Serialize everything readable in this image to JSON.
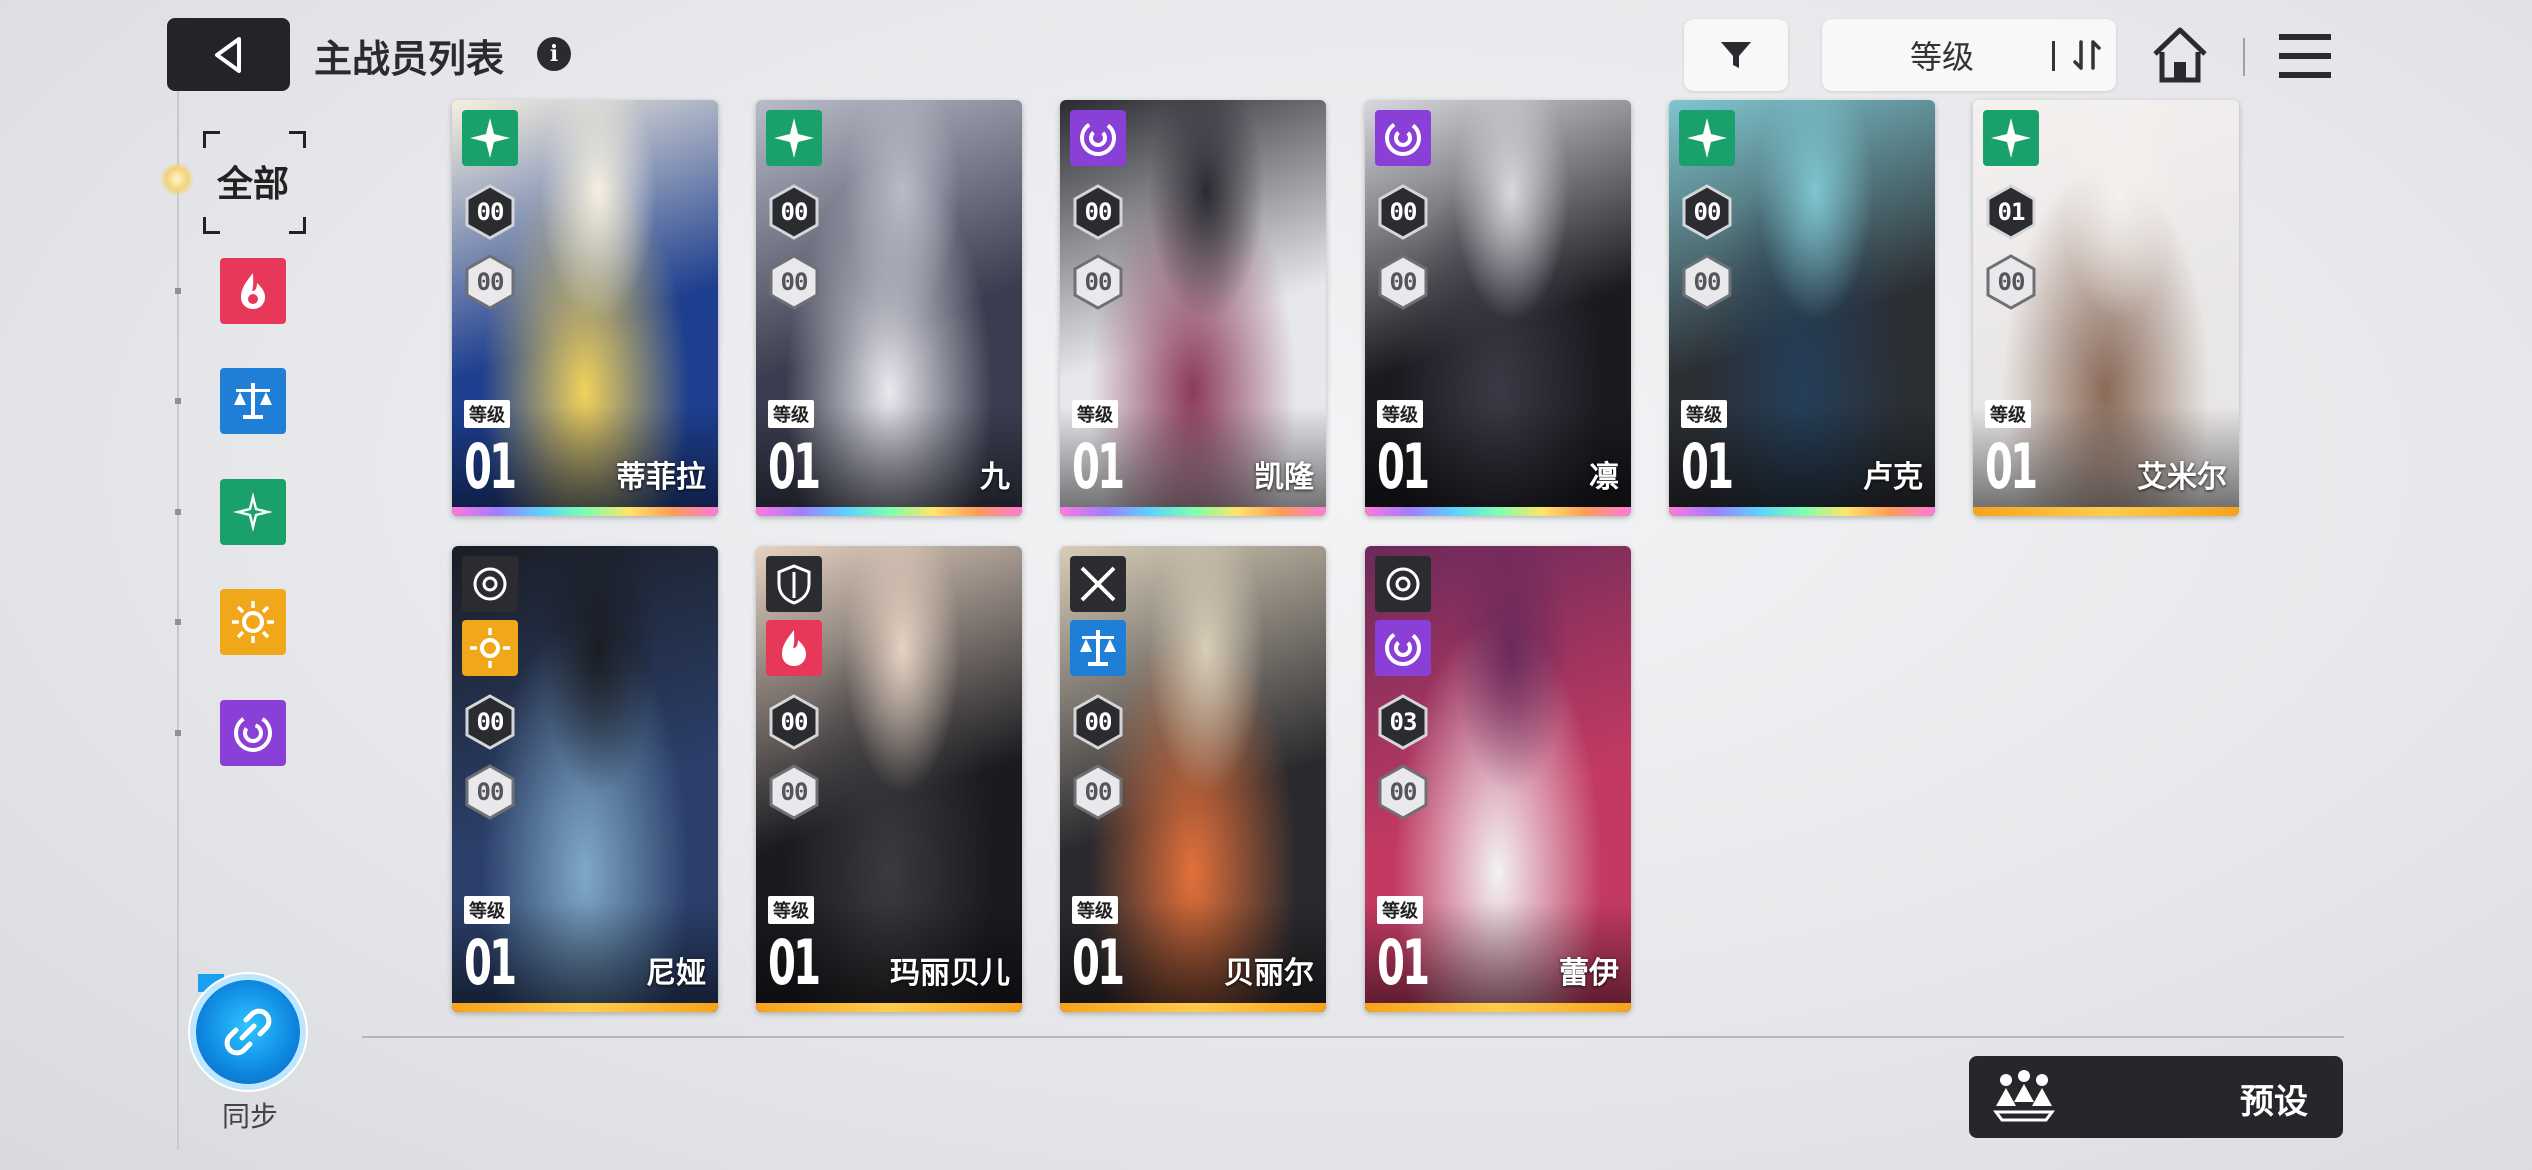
{
  "header": {
    "title": "主战员列表",
    "info_glyph": "i",
    "sort_label": "等级"
  },
  "sidebar": {
    "all_label": "全部",
    "filters": [
      {
        "name": "fire",
        "color": "#e8385a"
      },
      {
        "name": "balance",
        "color": "#1f7fd6"
      },
      {
        "name": "wind",
        "color": "#1aa06a"
      },
      {
        "name": "sun",
        "color": "#f0a81a"
      },
      {
        "name": "void",
        "color": "#8a3fd6"
      }
    ],
    "sync_label": "同步"
  },
  "cards": [
    {
      "name": "蒂菲拉",
      "level_label": "等级",
      "level": "01",
      "stat1": "00",
      "stat2": "00",
      "element": "wind",
      "bar": "rainbow",
      "palette": [
        "#1e3f8f",
        "#f1d25a",
        "#f6f0e0"
      ]
    },
    {
      "name": "九",
      "level_label": "等级",
      "level": "01",
      "stat1": "00",
      "stat2": "00",
      "element": "wind",
      "bar": "rainbow",
      "palette": [
        "#3a3d4f",
        "#e9e9ef",
        "#b9bcc8"
      ]
    },
    {
      "name": "凯隆",
      "level_label": "等级",
      "level": "01",
      "stat1": "00",
      "stat2": "00",
      "element": "void",
      "bar": "rainbow",
      "palette": [
        "#e7e8ec",
        "#8b3a5a",
        "#2a2b32"
      ]
    },
    {
      "name": "凛",
      "level_label": "等级",
      "level": "01",
      "stat1": "00",
      "stat2": "00",
      "element": "void",
      "bar": "rainbow",
      "palette": [
        "#1a1a20",
        "#3a3a46",
        "#d8d8de"
      ]
    },
    {
      "name": "卢克",
      "level_label": "等级",
      "level": "01",
      "stat1": "00",
      "stat2": "00",
      "element": "wind",
      "bar": "rainbow",
      "palette": [
        "#2b2e33",
        "#243f5a",
        "#7fc6d0"
      ]
    },
    {
      "name": "艾米尔",
      "level_label": "等级",
      "level": "01",
      "stat1": "01",
      "stat2": "00",
      "element": "wind",
      "bar": "orange",
      "palette": [
        "#e9e6e6",
        "#8a6a58",
        "#f4f1ef"
      ]
    },
    {
      "name": "尼娅",
      "level_label": "等级",
      "level": "01",
      "stat1": "00",
      "stat2": "00",
      "element": "sun",
      "role": "target",
      "bar": "orange",
      "palette": [
        "#2b3f6a",
        "#7fa8c8",
        "#1a1d24"
      ]
    },
    {
      "name": "玛丽贝儿",
      "level_label": "等级",
      "level": "01",
      "stat1": "00",
      "stat2": "00",
      "element": "fire",
      "role": "shield",
      "bar": "orange",
      "palette": [
        "#1a1b20",
        "#3b3a3e",
        "#e6d2c2"
      ]
    },
    {
      "name": "贝丽尔",
      "level_label": "等级",
      "level": "01",
      "stat1": "00",
      "stat2": "00",
      "element": "balance",
      "role": "swords",
      "bar": "orange",
      "palette": [
        "#2a2a2e",
        "#e3703a",
        "#d8cdb8"
      ]
    },
    {
      "name": "蕾伊",
      "level_label": "等级",
      "level": "01",
      "stat1": "03",
      "stat2": "00",
      "element": "void",
      "role": "target",
      "bar": "orange",
      "palette": [
        "#c23a62",
        "#f2f2f4",
        "#6a2a5a"
      ]
    }
  ],
  "preset": {
    "label": "预设"
  },
  "colors": {
    "fire": "#e8385a",
    "balance": "#1f7fd6",
    "wind": "#1aa06a",
    "sun": "#f0a81a",
    "void": "#8a3fd6"
  }
}
